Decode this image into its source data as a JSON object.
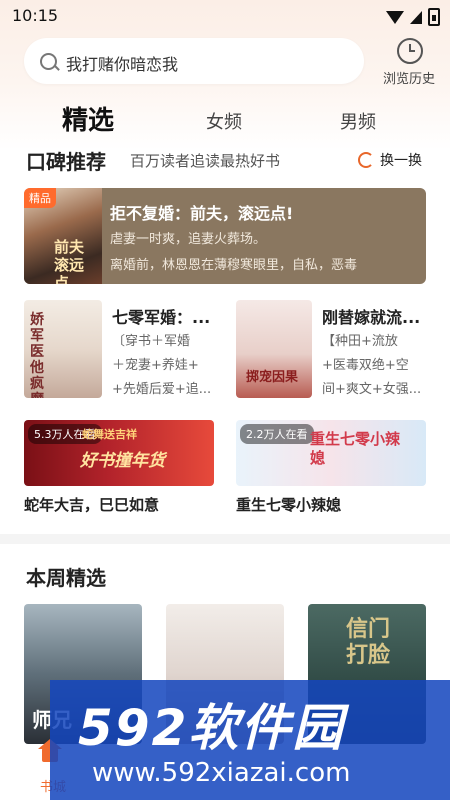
{
  "status_bar": {
    "time": "10:15"
  },
  "search": {
    "query": "我打赌你暗恋我"
  },
  "history": {
    "label": "浏览历史"
  },
  "tabs": [
    {
      "label": "精选",
      "active": true
    },
    {
      "label": "女频",
      "active": false
    },
    {
      "label": "男频",
      "active": false
    }
  ],
  "recommend": {
    "title": "口碑推荐",
    "subtitle": "百万读者追读最热好书",
    "refresh_label": "换一换"
  },
  "featured": {
    "badge": "精品",
    "title": "拒不复婚：前夫，滚远点!",
    "desc1": "虐妻一时爽，追妻火葬场。",
    "desc2": "离婚前，林恩恩在薄穆寒眼里，自私，恶毒",
    "cover_text": "前夫滚远点",
    "color": "#8a7760"
  },
  "books": [
    {
      "title": "七零军婚：...",
      "tag1": "〔穿书＋军婚",
      "tag2": "＋宠妻+养娃+",
      "tag3": "+先婚后爱+追...",
      "cover_text": "娇军医他疯魔"
    },
    {
      "title": "刚替嫁就流...",
      "tag1": "【种田+流放",
      "tag2": "+医毒双绝+空",
      "tag3": "间+爽文+女强...",
      "cover_text": "掷宠因果"
    }
  ],
  "banners": [
    {
      "badge": "5.3万人在看",
      "art_text": "好书撞年货",
      "art_top": "蛇舞送吉祥",
      "title": "蛇年大吉，巳巳如意"
    },
    {
      "badge": "2.2万人在看",
      "art_text": "重生七零小辣媳",
      "title": "重生七零小辣媳"
    }
  ],
  "weekly": {
    "title": "本周精选",
    "covers": [
      {
        "cover_text": "师兄"
      },
      {
        "cover_text": ""
      },
      {
        "cover_text": "信门打脸"
      }
    ]
  },
  "bottom_nav": {
    "home_label": "书城"
  },
  "watermark": {
    "logo": "592软件园",
    "url": "www.592xiazai.com"
  },
  "colors": {
    "accent": "#f06b2e",
    "watermark": "#1446be"
  }
}
